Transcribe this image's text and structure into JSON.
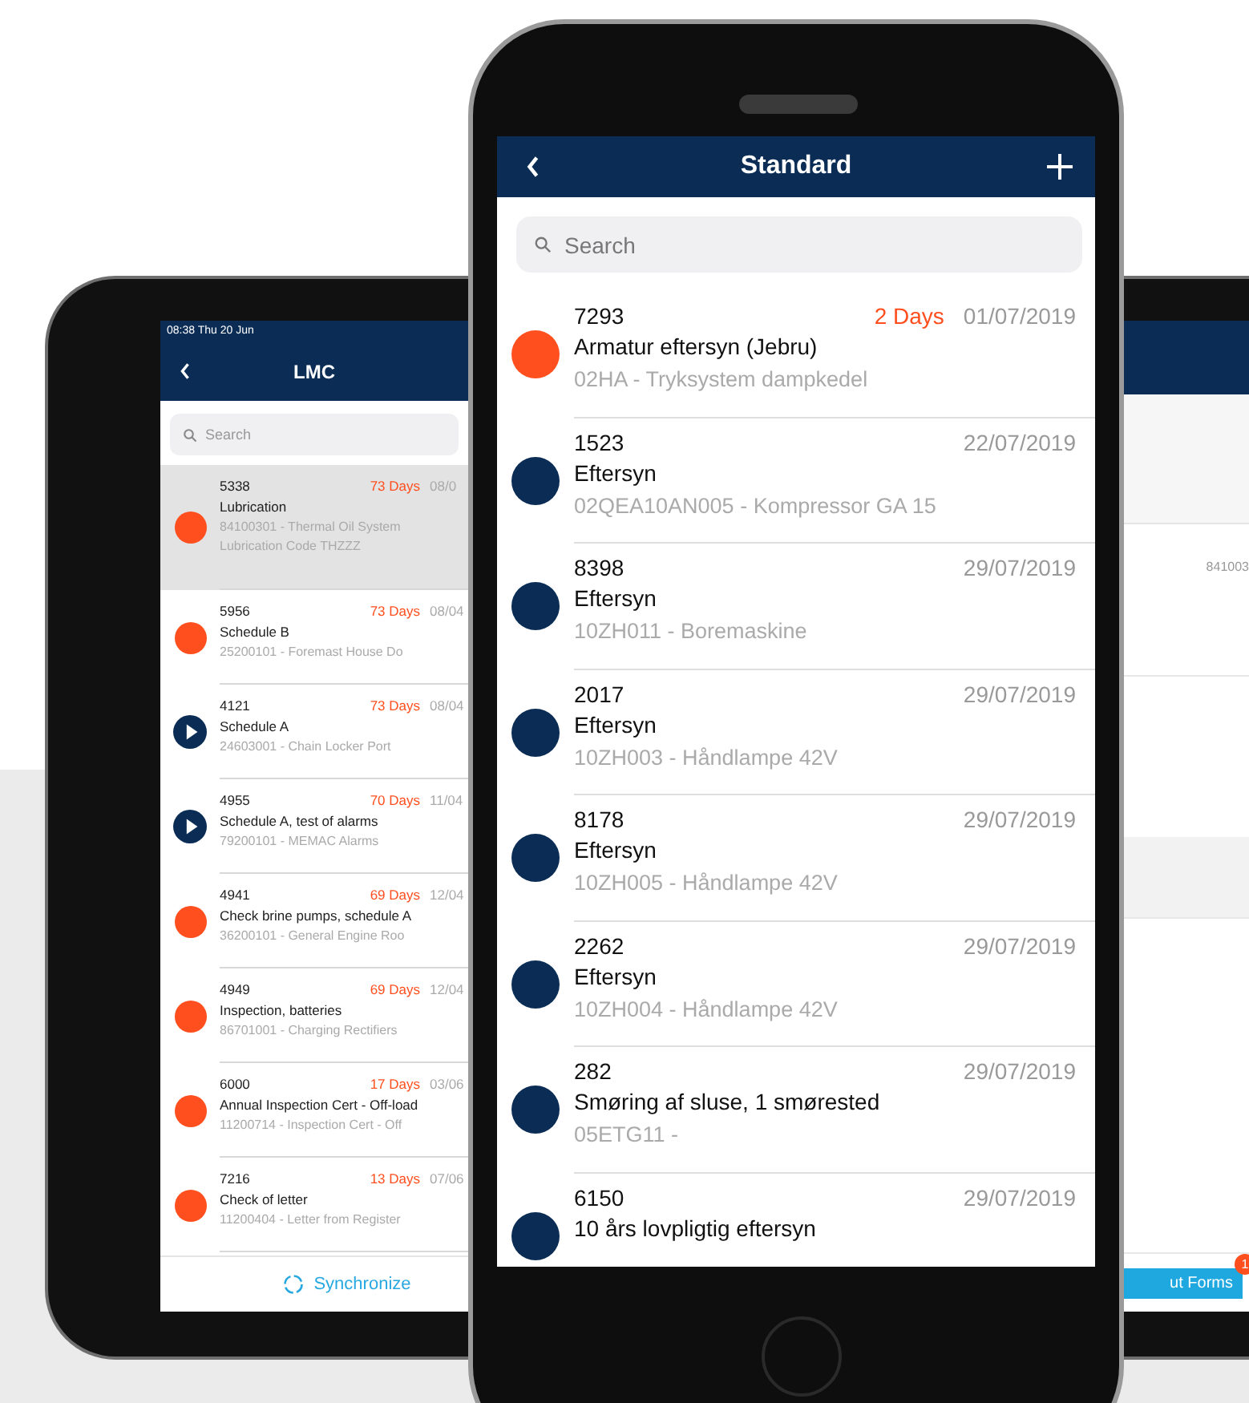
{
  "tablet": {
    "status_bar": "08:38  Thu 20 Jun",
    "title": "LMC",
    "search": {
      "placeholder": "Search"
    },
    "items": [
      {
        "number": "5338",
        "days": "73 Days",
        "date": "08/0",
        "title": "Lubrication",
        "subtitle": "84100301 - Thermal Oil System",
        "note": "Lubrication Code THZZZ",
        "kind": "dot",
        "color": "#ff4f1f",
        "selected": true
      },
      {
        "number": "5956",
        "days": "73 Days",
        "date": "08/04",
        "title": "Schedule B",
        "subtitle": "25200101 - Foremast House Do",
        "kind": "dot",
        "color": "#ff4f1f",
        "selected": false
      },
      {
        "number": "4121",
        "days": "73 Days",
        "date": "08/04",
        "title": "Schedule A",
        "subtitle": "24603001 - Chain Locker Port",
        "kind": "play",
        "selected": false
      },
      {
        "number": "4955",
        "days": "70 Days",
        "date": "11/04",
        "title": "Schedule A, test of alarms",
        "subtitle": "79200101 - MEMAC Alarms",
        "kind": "play",
        "selected": false
      },
      {
        "number": "4941",
        "days": "69 Days",
        "date": "12/04",
        "title": "Check brine pumps, schedule A",
        "subtitle": "36200101 - General Engine Roo",
        "kind": "dot",
        "color": "#ff4f1f",
        "selected": false
      },
      {
        "number": "4949",
        "days": "69 Days",
        "date": "12/04",
        "title": "Inspection, batteries",
        "subtitle": "86701001 - Charging Rectifiers",
        "kind": "dot",
        "color": "#ff4f1f",
        "selected": false
      },
      {
        "number": "6000",
        "days": "17 Days",
        "date": "03/06",
        "title": "Annual Inspection Cert - Off-load",
        "subtitle": "11200714 - Inspection Cert - Off",
        "kind": "dot",
        "color": "#ff4f1f",
        "selected": false
      },
      {
        "number": "7216",
        "days": "13 Days",
        "date": "07/06",
        "title": "Check of letter",
        "subtitle": "11200404 - Letter from Register",
        "kind": "dot",
        "color": "#ff4f1f",
        "selected": false
      }
    ],
    "sync_button": "Synchronize",
    "detail": {
      "code": "841003",
      "forms_button": "ut Forms",
      "badge": "1"
    }
  },
  "phone": {
    "title": "Standard",
    "search": {
      "placeholder": "Search"
    },
    "items": [
      {
        "number": "7293",
        "days": "2 Days",
        "date": "01/07/2019",
        "title": "Armatur eftersyn (Jebru)",
        "subtitle": "02HA - Tryksystem dampkedel",
        "kind": "dot",
        "color": "#ff4f1f"
      },
      {
        "number": "1523",
        "date": "22/07/2019",
        "title": "Eftersyn",
        "subtitle": "02QEA10AN005 - Kompressor GA 15",
        "kind": "dot",
        "color": "#0b2d55"
      },
      {
        "number": "8398",
        "date": "29/07/2019",
        "title": "Eftersyn",
        "subtitle": "10ZH011 - Boremaskine",
        "kind": "dot",
        "color": "#0b2d55"
      },
      {
        "number": "2017",
        "date": "29/07/2019",
        "title": "Eftersyn",
        "subtitle": "10ZH003 - Håndlampe 42V",
        "kind": "dot",
        "color": "#0b2d55"
      },
      {
        "number": "8178",
        "date": "29/07/2019",
        "title": "Eftersyn",
        "subtitle": "10ZH005 - Håndlampe 42V",
        "kind": "dot",
        "color": "#0b2d55"
      },
      {
        "number": "2262",
        "date": "29/07/2019",
        "title": "Eftersyn",
        "subtitle": "10ZH004 - Håndlampe 42V",
        "kind": "dot",
        "color": "#0b2d55"
      },
      {
        "number": "282",
        "date": "29/07/2019",
        "title": "Smøring af sluse, 1 smørested",
        "subtitle": "05ETG11 -",
        "kind": "dot",
        "color": "#0b2d55"
      },
      {
        "number": "6150",
        "date": "29/07/2019",
        "title": "10 års lovpligtig eftersyn",
        "kind": "dot",
        "color": "#0b2d55"
      }
    ]
  }
}
